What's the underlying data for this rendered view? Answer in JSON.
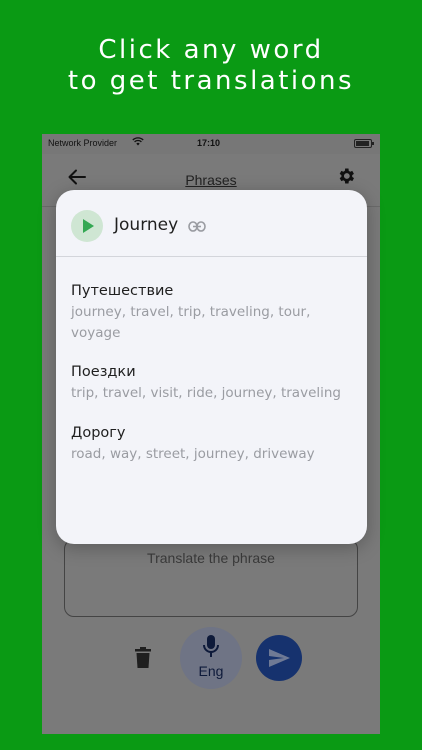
{
  "headline": {
    "line1": "Click any word",
    "line2": "to get translations"
  },
  "status_bar": {
    "carrier": "Network Provider",
    "time": "17:10"
  },
  "app_bar": {
    "title": "Phrases"
  },
  "input": {
    "placeholder": "Translate the phrase"
  },
  "mic": {
    "language": "Eng"
  },
  "popup": {
    "word": "Journey",
    "translations": [
      {
        "word": "Путешествие",
        "synonyms": "journey, travel, trip, traveling, tour, voyage"
      },
      {
        "word": "Поездки",
        "synonyms": "trip, travel, visit, ride, journey, traveling"
      },
      {
        "word": "Дорогу",
        "synonyms": "road, way, street, journey, driveway"
      }
    ]
  },
  "colors": {
    "background": "#0a9a14",
    "play_accent": "#34a853",
    "send_button": "#16326e"
  }
}
